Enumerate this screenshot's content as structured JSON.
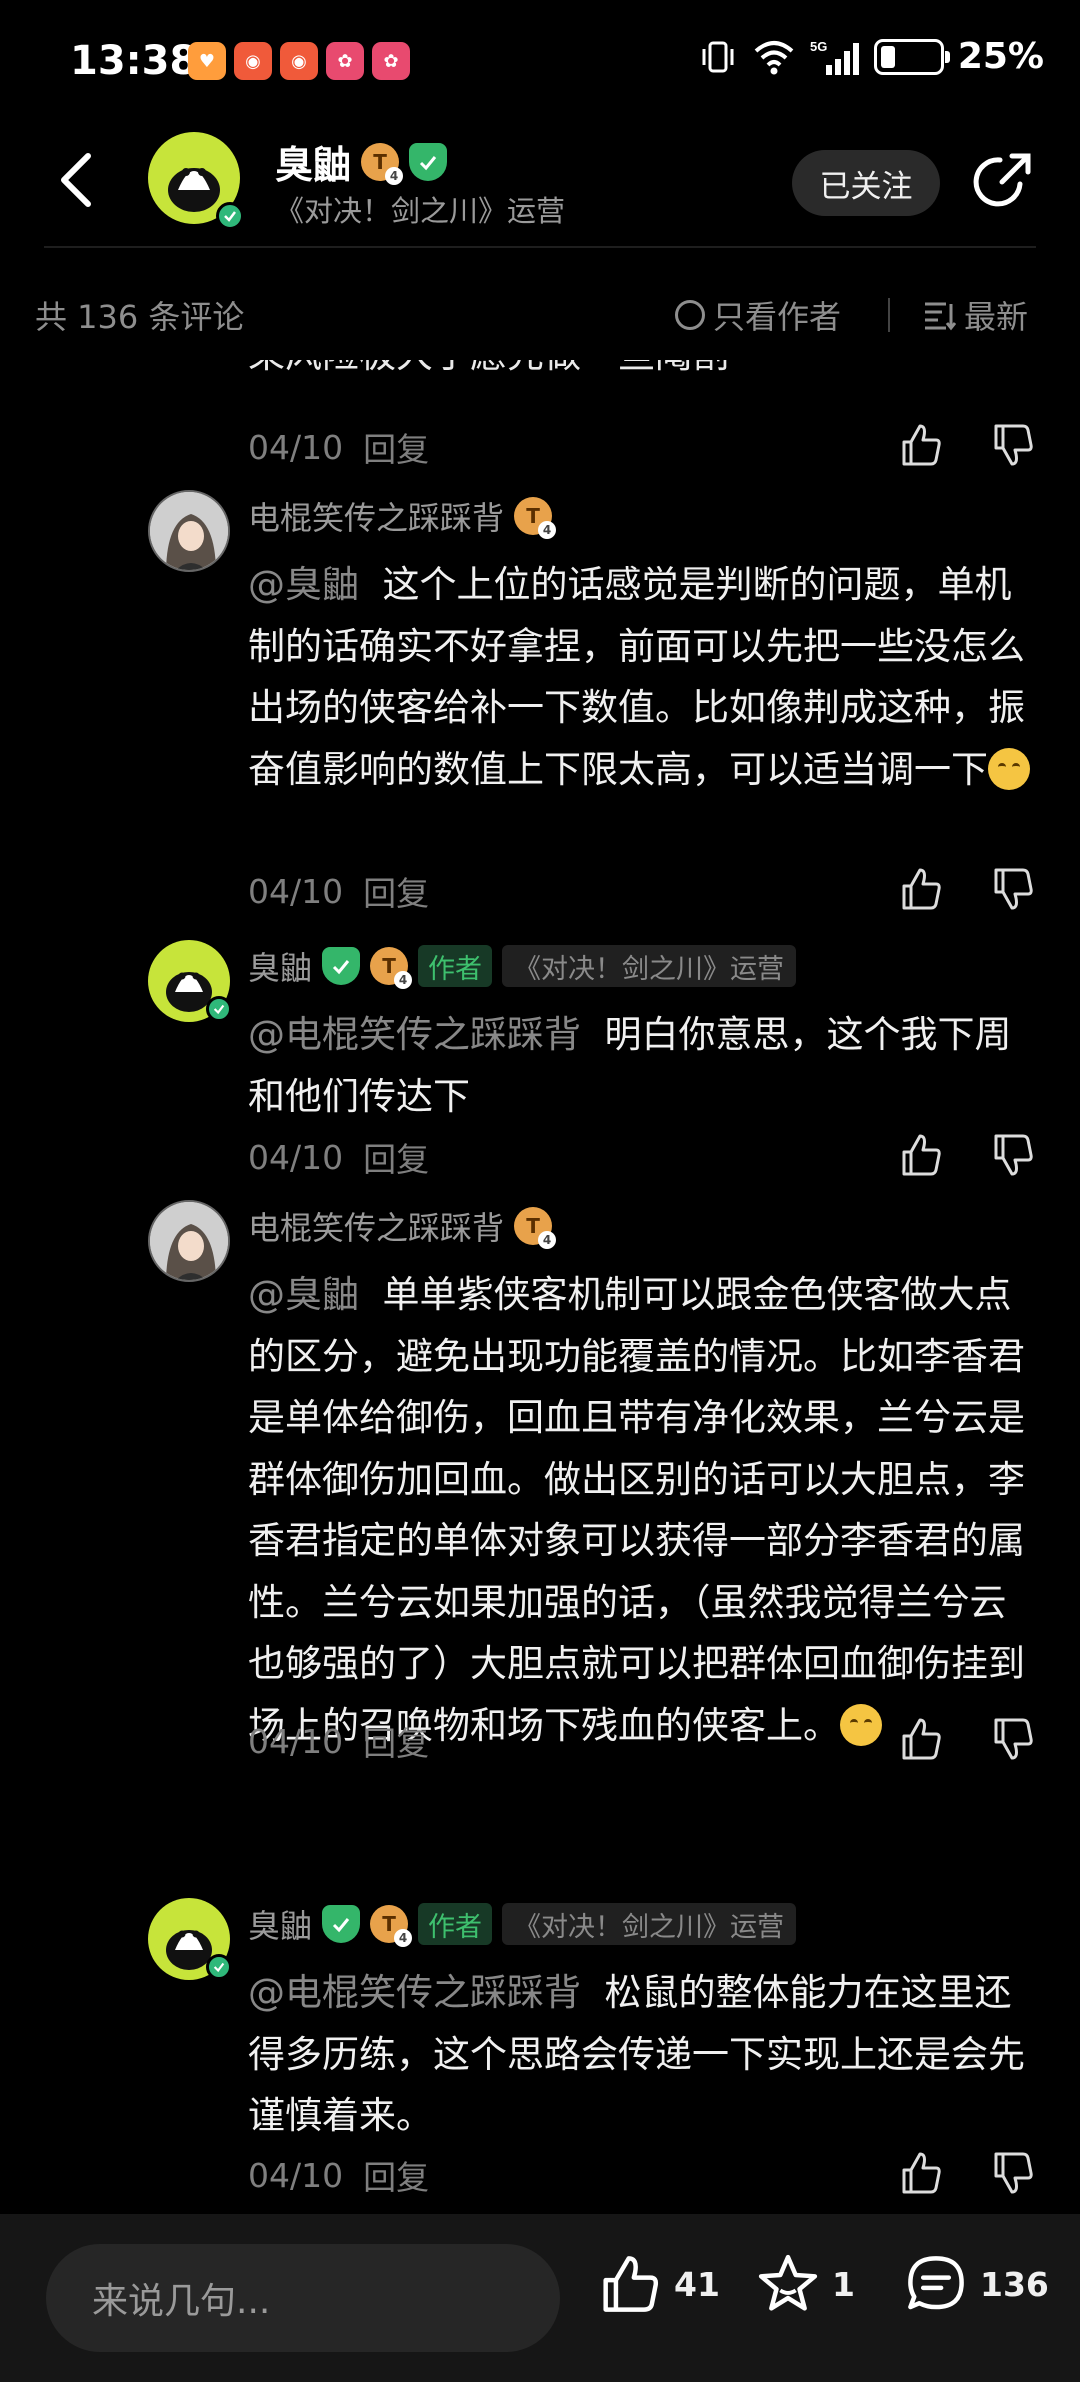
{
  "status_bar": {
    "time": "13:38",
    "battery_level": 0.25,
    "battery_text": "25%",
    "network": "5G"
  },
  "header": {
    "name": "臭鼬",
    "subtitle": "《对决！剑之川》运营",
    "follow_label": "已关注"
  },
  "filter": {
    "count_text": "共 136 条评论",
    "author_only": "只看作者",
    "sort_latest": "最新"
  },
  "feed": {
    "cut_text": "果风险极大于愿先做一些阉割",
    "first_meta": {
      "date": "04/10",
      "reply": "回复"
    },
    "replies": [
      {
        "name": "电棍笑传之踩踩背",
        "mention": "@臭鼬",
        "text": "这个上位的话感觉是判断的问题，单机制的话确实不好拿捏，前面可以先把一些没怎么出场的侠客给补一下数值。比如像荆成这种，振奋值影响的数值上下限太高，可以适当调一下",
        "date": "04/10",
        "reply": "回复"
      },
      {
        "name": "臭鼬",
        "author_tag": "作者",
        "role": "《对决！剑之川》运营",
        "mention": "@电棍笑传之踩踩背",
        "text": "明白你意思，这个我下周和他们传达下",
        "date": "04/10",
        "reply": "回复"
      },
      {
        "name": "电棍笑传之踩踩背",
        "mention": "@臭鼬",
        "text": "单单紫侠客机制可以跟金色侠客做大点的区分，避免出现功能覆盖的情况。比如李香君是单体给御伤，回血且带有净化效果，兰兮云是群体御伤加回血。做出区别的话可以大胆点，李香君指定的单体对象可以获得一部分李香君的属性。兰兮云如果加强的话，（虽然我觉得兰兮云也够强的了）大胆点就可以把群体回血御伤挂到场上的召唤物和场下残血的侠客上。",
        "date": "04/10",
        "reply": "回复"
      },
      {
        "name": "臭鼬",
        "author_tag": "作者",
        "role": "《对决！剑之川》运营",
        "mention": "@电棍笑传之踩踩背",
        "text": "松鼠的整体能力在这里还得多历练，这个思路会传递一下实现上还是会先谨慎着来。",
        "date": "04/10",
        "reply": "回复"
      }
    ]
  },
  "bottom_bar": {
    "input_placeholder": "来说几句...",
    "likes": "41",
    "favorites": "1",
    "comments": "136"
  },
  "colors": {
    "background": "#000000",
    "author_green": "#3ec06e",
    "level_orange": "#e8a24b",
    "avatar_lime": "#c7e43a"
  }
}
